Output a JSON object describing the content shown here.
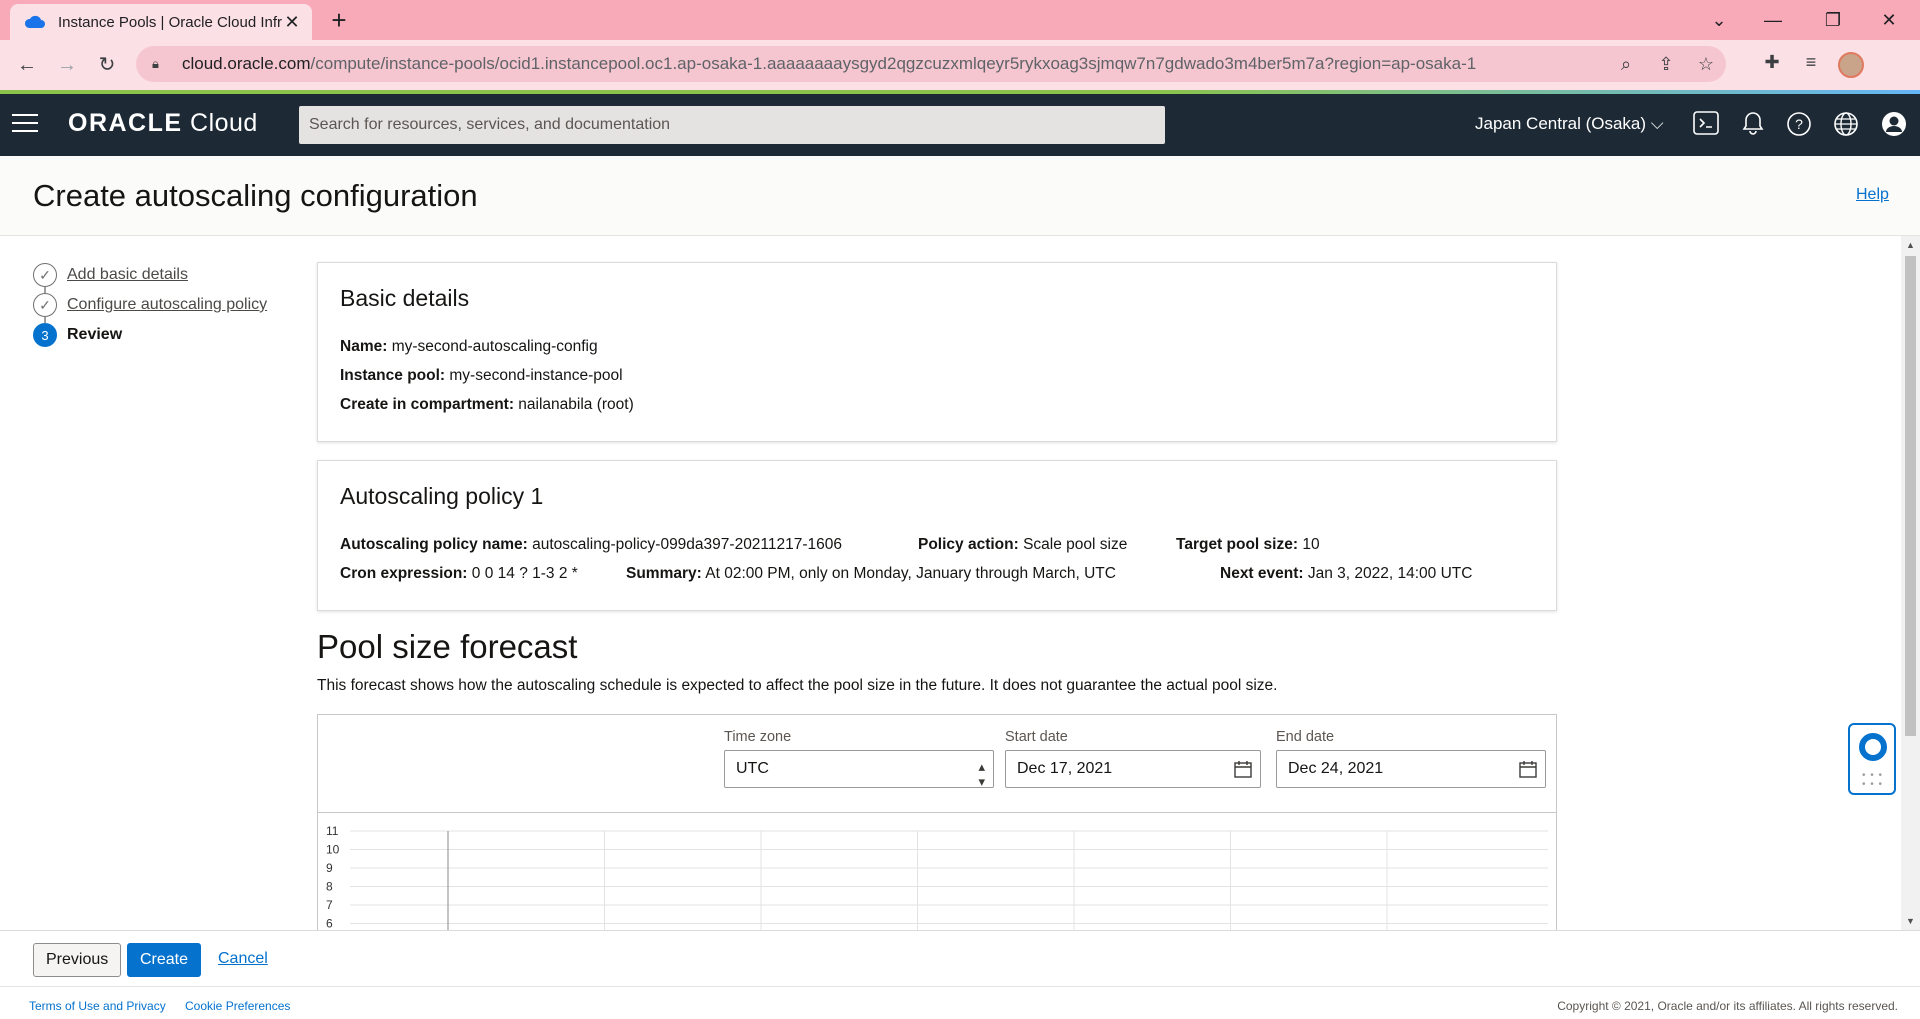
{
  "browser": {
    "tab_title": "Instance Pools | Oracle Cloud Infr",
    "url_host": "cloud.oracle.com",
    "url_path": "/compute/instance-pools/ocid1.instancepool.oc1.ap-osaka-1.aaaaaaaaysgyd2qgzcuzxmlqeyr5rykxoag3sjmqw7n7gdwado3m4ber5m7a?region=ap-osaka-1"
  },
  "header": {
    "brand_strong": "ORACLE",
    "brand_light": " Cloud",
    "search_placeholder": "Search for resources, services, and documentation",
    "region": "Japan Central (Osaka)"
  },
  "page": {
    "title": "Create autoscaling configuration",
    "help": "Help"
  },
  "steps": [
    {
      "label": "Add basic details",
      "marker": "✓"
    },
    {
      "label": "Configure autoscaling policy",
      "marker": "✓"
    },
    {
      "label": "Review",
      "marker": "3"
    }
  ],
  "basic_details": {
    "heading": "Basic details",
    "name_label": "Name:",
    "name_value": "my-second-autoscaling-config",
    "pool_label": "Instance pool:",
    "pool_value": "my-second-instance-pool",
    "compartment_label": "Create in compartment:",
    "compartment_value": "nailanabila (root)"
  },
  "policy": {
    "heading": "Autoscaling policy 1",
    "policy_name_label": "Autoscaling policy name:",
    "policy_name_value": "autoscaling-policy-099da397-20211217-1606",
    "action_label": "Policy action:",
    "action_value": "Scale pool size",
    "target_label": "Target pool size:",
    "target_value": "10",
    "cron_label": "Cron expression:",
    "cron_value": "0 0 14 ? 1-3 2 *",
    "summary_label": "Summary:",
    "summary_value": "At 02:00 PM, only on Monday, January through March, UTC",
    "next_label": "Next event:",
    "next_value": "Jan 3, 2022, 14:00 UTC"
  },
  "forecast": {
    "title": "Pool size forecast",
    "description": "This forecast shows how the autoscaling schedule is expected to affect the pool size in the future. It does not guarantee the actual pool size.",
    "timezone_label": "Time zone",
    "timezone_value": "UTC",
    "start_label": "Start date",
    "start_value": "Dec 17, 2021",
    "end_label": "End date",
    "end_value": "Dec 24, 2021"
  },
  "chart_data": {
    "type": "line",
    "title": "",
    "xlabel": "",
    "ylabel": "",
    "y_ticks": [
      11,
      10,
      9,
      8,
      7,
      6
    ],
    "ylim": [
      6,
      11
    ],
    "grid": true,
    "series": []
  },
  "footer": {
    "previous": "Previous",
    "create": "Create",
    "cancel": "Cancel",
    "terms": "Terms of Use and Privacy",
    "cookies": "Cookie Preferences",
    "copyright": "Copyright © 2021, Oracle and/or its affiliates. All rights reserved."
  },
  "colors": {
    "accent": "#0572ce",
    "header_bg": "#1d2a36",
    "tabstrip_bg": "#f9aab9"
  }
}
